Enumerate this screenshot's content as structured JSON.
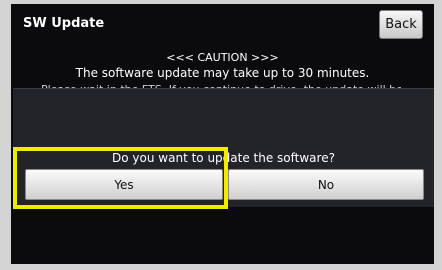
{
  "header": {
    "title": "SW Update",
    "back_label": "Back"
  },
  "caution": {
    "heading": "<<< CAUTION >>>",
    "line1": "The software update may take up to 30 minutes.",
    "line2_partial": "Please wait in the FTS. If you continue to drive, the update will be applied the next time."
  },
  "dialog": {
    "question": "Do you want to update the software?",
    "yes_label": "Yes",
    "no_label": "No"
  },
  "colors": {
    "screen_bg": "#0b0b0e",
    "dialog_bg": "#23232a",
    "highlight": "#f2ea00"
  }
}
